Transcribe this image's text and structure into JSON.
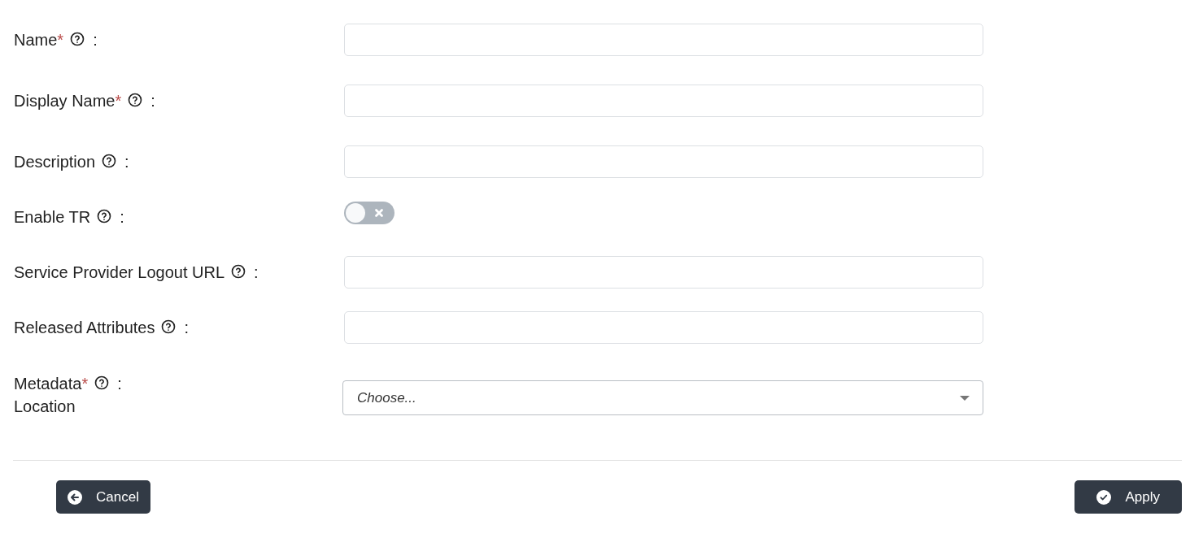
{
  "fields": [
    {
      "kind": "text",
      "label": "Name",
      "required": true
    },
    {
      "kind": "text",
      "label": "Display Name",
      "required": true
    },
    {
      "kind": "text",
      "label": "Description",
      "required": false
    },
    {
      "kind": "toggle",
      "label": "Enable TR",
      "required": false,
      "on": false
    },
    {
      "kind": "text",
      "label": "Service Provider Logout URL",
      "required": false
    },
    {
      "kind": "text",
      "label": "Released Attributes",
      "required": false
    },
    {
      "kind": "select",
      "label": "Metadata",
      "label_line2": "Location",
      "required": true,
      "placeholder": "Choose..."
    }
  ],
  "required_mark": "*",
  "separator": ":",
  "buttons": [
    {
      "kind": "back",
      "label": "Cancel"
    },
    {
      "kind": "confirm",
      "label": "Apply"
    }
  ]
}
